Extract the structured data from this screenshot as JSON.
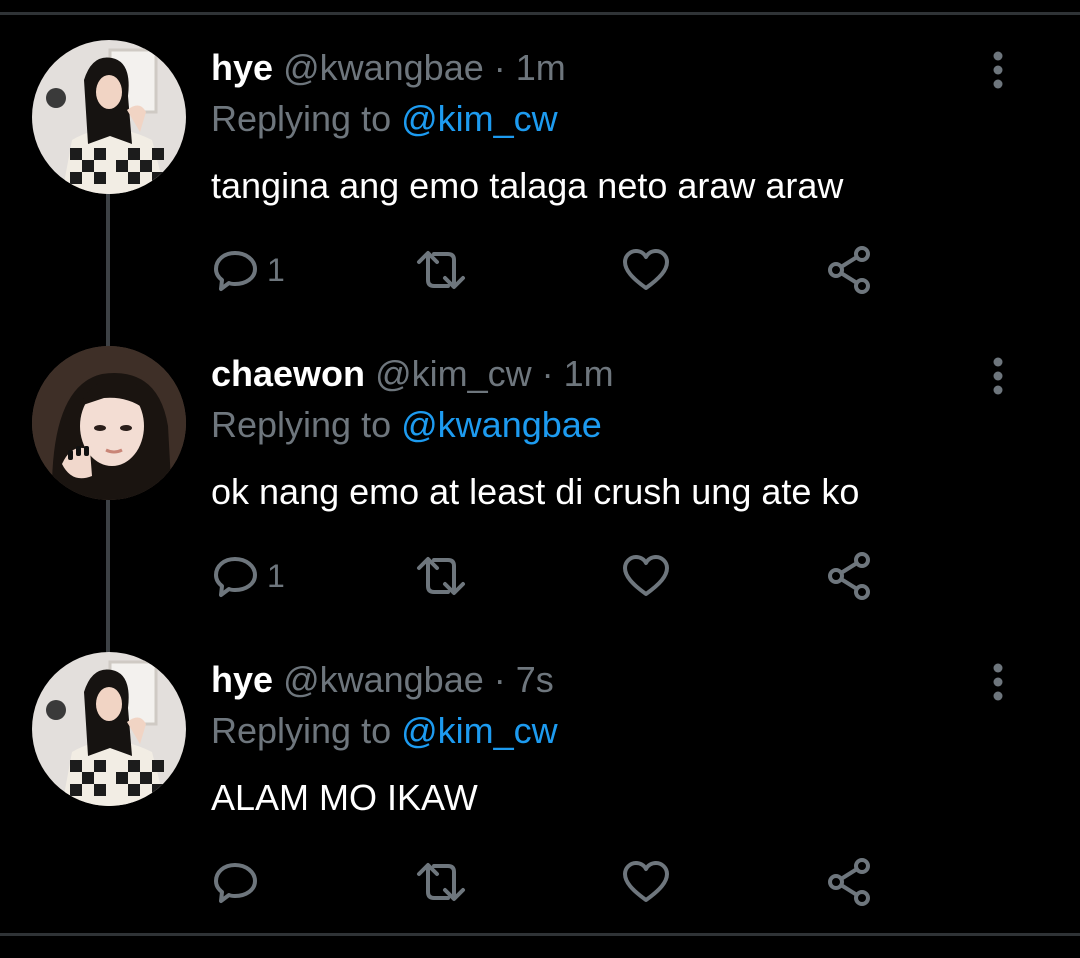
{
  "tweets": [
    {
      "name": "hye",
      "handle": "@kwangbae",
      "separator": "·",
      "time": "1m",
      "replying_prefix": "Replying to",
      "replying_to": "@kim_cw",
      "text": "tangina ang emo talaga neto araw araw",
      "reply_count": "1",
      "avatar_icon": "profile-photo-hye"
    },
    {
      "name": "chaewon",
      "handle": "@kim_cw",
      "separator": "·",
      "time": "1m",
      "replying_prefix": "Replying to",
      "replying_to": "@kwangbae",
      "text": "ok nang emo at least di crush ung ate ko",
      "reply_count": "1",
      "avatar_icon": "profile-photo-chaewon"
    },
    {
      "name": "hye",
      "handle": "@kwangbae",
      "separator": "·",
      "time": "7s",
      "replying_prefix": "Replying to",
      "replying_to": "@kim_cw",
      "text": "ALAM MO IKAW",
      "reply_count": "",
      "avatar_icon": "profile-photo-hye"
    }
  ],
  "colors": {
    "background": "#000000",
    "text": "#ffffff",
    "muted": "#6e767d",
    "mention": "#1d9bf0",
    "thread_line": "#3d4145"
  },
  "icons": [
    "reply-icon",
    "retweet-icon",
    "like-icon",
    "share-icon",
    "more-options-icon"
  ]
}
